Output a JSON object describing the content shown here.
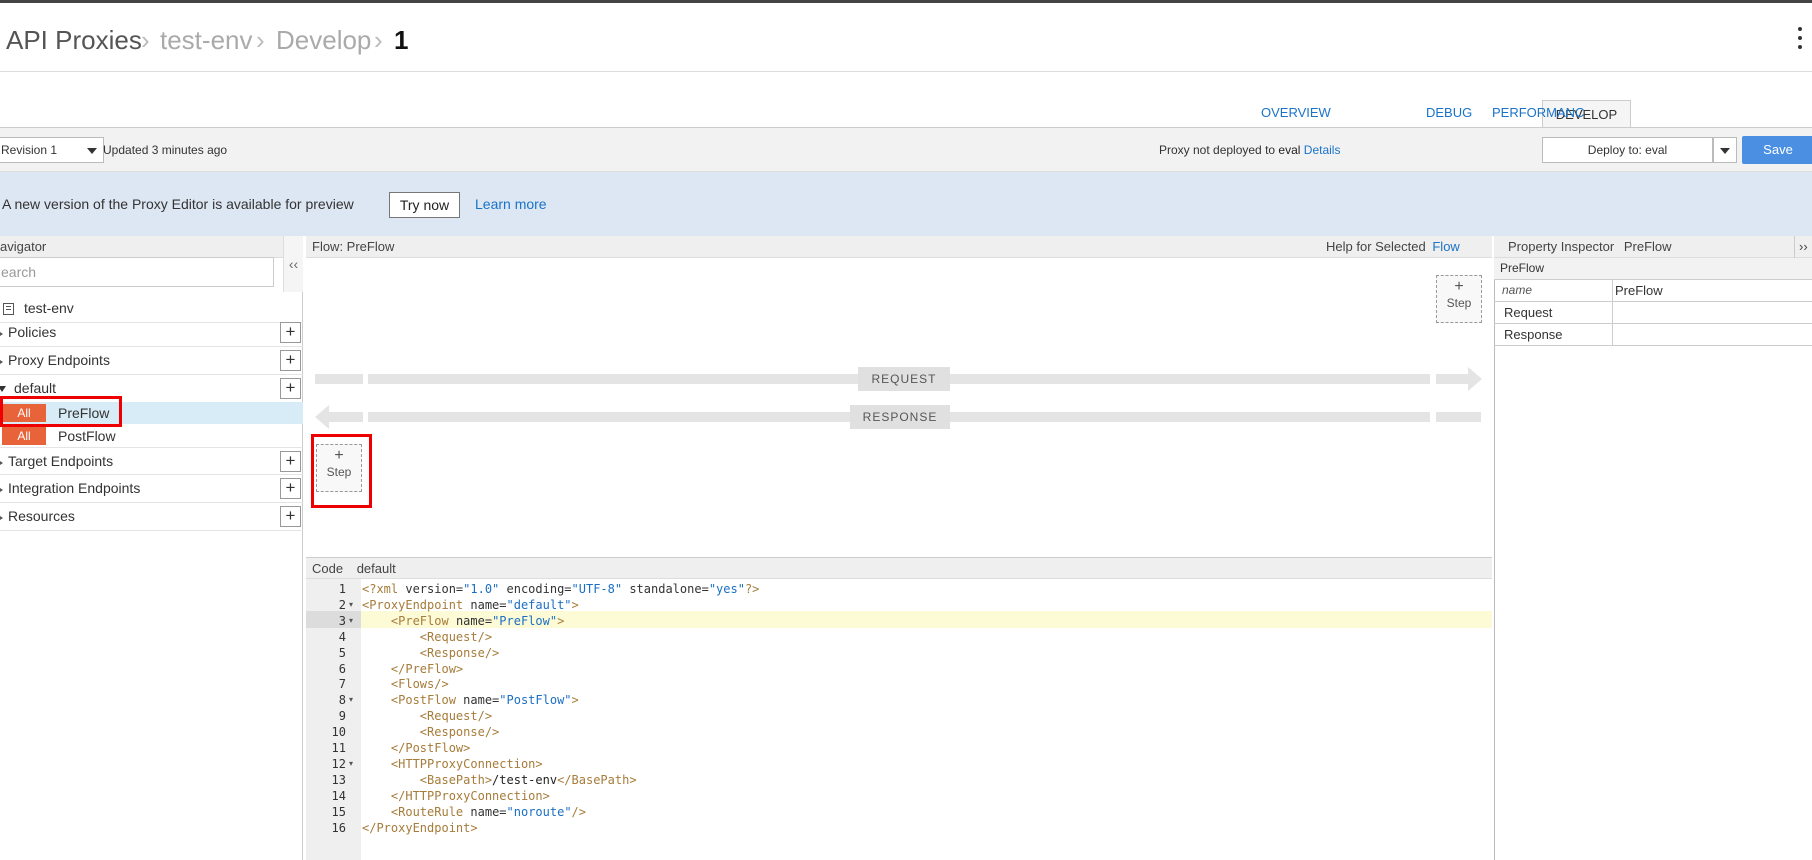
{
  "breadcrumb": {
    "root": "API Proxies",
    "env": "test-env",
    "section": "Develop",
    "revision": "1",
    "sep": "›"
  },
  "tabs": [
    "OVERVIEW",
    "DEVELOP",
    "DEBUG",
    "PERFORMANC"
  ],
  "toolbar": {
    "revision_select": "Revision 1",
    "updated": "Updated 3 minutes ago",
    "deploy_status_prefix": "Proxy not deployed to",
    "deploy_status_env": "eval",
    "details_link": "Details",
    "deploy_select": "Deploy to: eval",
    "save_label": "Save"
  },
  "banner": {
    "message": "A new version of the Proxy Editor is available for preview",
    "try_now": "Try now",
    "learn_more": "Learn more"
  },
  "navigator": {
    "title": "avigator",
    "search_placeholder": "earch",
    "collapse": "‹‹",
    "proxy_name": "test-env",
    "policies": "Policies",
    "proxy_endpoints": "Proxy Endpoints",
    "default": "default",
    "flows": [
      {
        "badge": "All",
        "label": "PreFlow"
      },
      {
        "badge": "All",
        "label": "PostFlow"
      }
    ],
    "target_endpoints": "Target Endpoints",
    "integration_endpoints": "Integration Endpoints",
    "resources": "Resources",
    "plus": "+"
  },
  "flow": {
    "title": "Flow: PreFlow",
    "help_prefix": "Help for Selected",
    "help_link": "Flow",
    "request_label": "REQUEST",
    "response_label": "RESPONSE",
    "step_plus": "+",
    "step_label": "Step"
  },
  "code": {
    "title": "Code",
    "name": "default",
    "lines": [
      {
        "n": "1",
        "fold": "",
        "segs": [
          [
            "tag",
            "<?xml "
          ],
          [
            "attr",
            "version="
          ],
          [
            "val",
            "\"1.0\""
          ],
          [
            "attr",
            " encoding="
          ],
          [
            "val",
            "\"UTF-8\""
          ],
          [
            "attr",
            " standalone="
          ],
          [
            "val",
            "\"yes\""
          ],
          [
            "tag",
            "?>"
          ]
        ]
      },
      {
        "n": "2",
        "fold": "▾",
        "segs": [
          [
            "tag",
            "<ProxyEndpoint "
          ],
          [
            "attr",
            "name="
          ],
          [
            "val",
            "\"default\""
          ],
          [
            "tag",
            ">"
          ]
        ]
      },
      {
        "n": "3",
        "fold": "▾",
        "segs": [
          [
            "txt",
            "    "
          ],
          [
            "tag",
            "<PreFlow "
          ],
          [
            "attr",
            "name="
          ],
          [
            "val",
            "\"PreFlow\""
          ],
          [
            "tag",
            ">"
          ]
        ]
      },
      {
        "n": "4",
        "fold": "",
        "segs": [
          [
            "txt",
            "        "
          ],
          [
            "tag",
            "<Request/>"
          ]
        ]
      },
      {
        "n": "5",
        "fold": "",
        "segs": [
          [
            "txt",
            "        "
          ],
          [
            "tag",
            "<Response/>"
          ]
        ]
      },
      {
        "n": "6",
        "fold": "",
        "segs": [
          [
            "txt",
            "    "
          ],
          [
            "tag",
            "</PreFlow>"
          ]
        ]
      },
      {
        "n": "7",
        "fold": "",
        "segs": [
          [
            "txt",
            "    "
          ],
          [
            "tag",
            "<Flows/>"
          ]
        ]
      },
      {
        "n": "8",
        "fold": "▾",
        "segs": [
          [
            "txt",
            "    "
          ],
          [
            "tag",
            "<PostFlow "
          ],
          [
            "attr",
            "name="
          ],
          [
            "val",
            "\"PostFlow\""
          ],
          [
            "tag",
            ">"
          ]
        ]
      },
      {
        "n": "9",
        "fold": "",
        "segs": [
          [
            "txt",
            "        "
          ],
          [
            "tag",
            "<Request/>"
          ]
        ]
      },
      {
        "n": "10",
        "fold": "",
        "segs": [
          [
            "txt",
            "        "
          ],
          [
            "tag",
            "<Response/>"
          ]
        ]
      },
      {
        "n": "11",
        "fold": "",
        "segs": [
          [
            "txt",
            "    "
          ],
          [
            "tag",
            "</PostFlow>"
          ]
        ]
      },
      {
        "n": "12",
        "fold": "▾",
        "segs": [
          [
            "txt",
            "    "
          ],
          [
            "tag",
            "<HTTPProxyConnection>"
          ]
        ]
      },
      {
        "n": "13",
        "fold": "",
        "segs": [
          [
            "txt",
            "        "
          ],
          [
            "tag",
            "<BasePath>"
          ],
          [
            "txt",
            "/test-env"
          ],
          [
            "tag",
            "</BasePath>"
          ]
        ]
      },
      {
        "n": "14",
        "fold": "",
        "segs": [
          [
            "txt",
            "    "
          ],
          [
            "tag",
            "</HTTPProxyConnection>"
          ]
        ]
      },
      {
        "n": "15",
        "fold": "",
        "segs": [
          [
            "txt",
            "    "
          ],
          [
            "tag",
            "<RouteRule "
          ],
          [
            "attr",
            "name="
          ],
          [
            "val",
            "\"noroute\""
          ],
          [
            "tag",
            "/>"
          ]
        ]
      },
      {
        "n": "16",
        "fold": "",
        "segs": [
          [
            "tag",
            "</ProxyEndpoint>"
          ]
        ]
      }
    ]
  },
  "inspector": {
    "title": "Property Inspector",
    "subject": "PreFlow",
    "expand": "››",
    "section": "PreFlow",
    "rows": [
      {
        "key": "name",
        "value": "PreFlow"
      },
      {
        "key": "Request",
        "value": ""
      },
      {
        "key": "Response",
        "value": ""
      }
    ]
  },
  "colors": {
    "accent_link": "#1a73c8",
    "save_button": "#4a8fe2",
    "badge": "#e8633a",
    "highlight_border": "#ee0000",
    "banner_bg": "#dde6f3"
  }
}
